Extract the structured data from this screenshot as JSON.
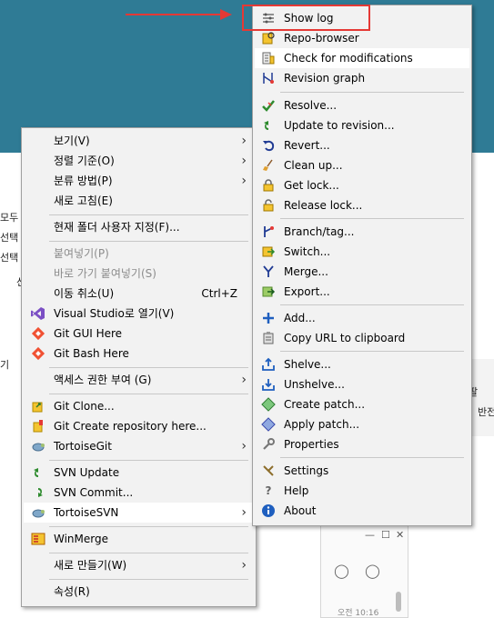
{
  "explorer": {
    "frag_1": "모두",
    "frag_2": "선택",
    "frag_3": "선택",
    "frag_4": "선",
    "frag_5": "기"
  },
  "right_panel": {
    "frag_1": "팔",
    "frag_2": "반전"
  },
  "chat": {
    "time": "오전 10:16"
  },
  "context_menu": {
    "view": "보기(V)",
    "sort": "정렬 기준(O)",
    "group": "분류 방법(P)",
    "refresh": "새로 고침(E)",
    "customize": "현재 폴더 사용자 지정(F)...",
    "paste": "붙여넣기(P)",
    "paste_shortcut": "바로 가기 붙여넣기(S)",
    "undo_move": "이동 취소(U)",
    "undo_shortcut": "Ctrl+Z",
    "open_vs": "Visual Studio로 열기(V)",
    "git_gui": "Git GUI Here",
    "git_bash": "Git Bash Here",
    "give_access": "액세스 권한 부여 (G)",
    "git_clone": "Git Clone...",
    "git_create_repo": "Git Create repository here...",
    "tortoise_git": "TortoiseGit",
    "svn_update": "SVN Update",
    "svn_commit": "SVN Commit...",
    "tortoise_svn": "TortoiseSVN",
    "winmerge": "WinMerge",
    "new": "새로 만들기(W)",
    "properties": "속성(R)"
  },
  "svn_submenu": {
    "show_log": "Show log",
    "repo_browser": "Repo-browser",
    "check_modifications": "Check for modifications",
    "revision_graph": "Revision graph",
    "resolve": "Resolve...",
    "update_to_revision": "Update to revision...",
    "revert": "Revert...",
    "clean_up": "Clean up...",
    "get_lock": "Get lock...",
    "release_lock": "Release lock...",
    "branch_tag": "Branch/tag...",
    "switch": "Switch...",
    "merge": "Merge...",
    "export": "Export...",
    "add": "Add...",
    "copy_url": "Copy URL to clipboard",
    "shelve": "Shelve...",
    "unshelve": "Unshelve...",
    "create_patch": "Create patch...",
    "apply_patch": "Apply patch...",
    "properties": "Properties",
    "settings": "Settings",
    "help": "Help",
    "about": "About"
  },
  "colors": {
    "desktop": "#2f7b95",
    "menu_bg": "#f2f2f2",
    "highlight_border": "#e53935",
    "hover": "#ffffff"
  }
}
